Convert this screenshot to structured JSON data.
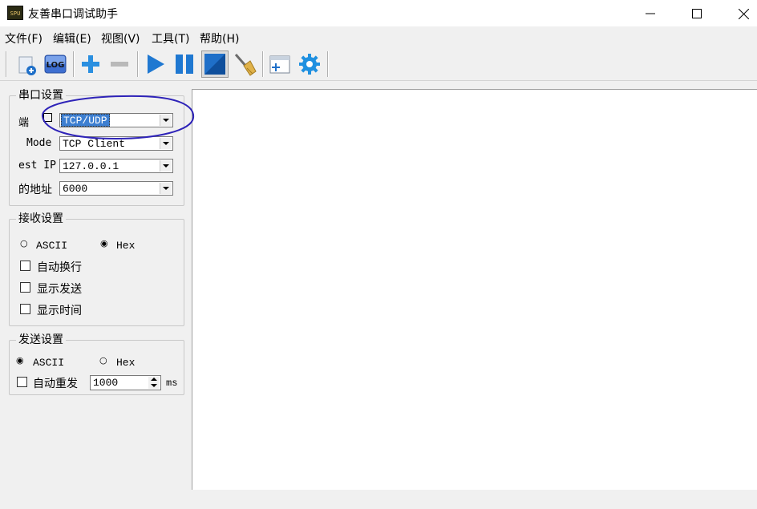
{
  "window": {
    "icon_text": "SPU",
    "title": "友善串口调试助手"
  },
  "menu": [
    {
      "label": "文件(F)"
    },
    {
      "label": "编辑(E)"
    },
    {
      "label": "视图(V)"
    },
    {
      "label": "工具(T)"
    },
    {
      "label": "帮助(H)"
    }
  ],
  "toolbar": {
    "log_label": "LOG",
    "icons": [
      "new-document-icon",
      "log-icon",
      "add-icon",
      "remove-icon",
      "play-icon",
      "pause-icon",
      "display-mode-icon",
      "clear-broom-icon",
      "new-window-icon",
      "settings-gear-icon"
    ]
  },
  "serial_settings": {
    "title": "串口设置",
    "port_label": "端",
    "port_value": "TCP/UDP",
    "mode_label": "Mode",
    "mode_value": "TCP Client",
    "host_ip_label": "est IP",
    "host_ip_value": "127.0.0.1",
    "port_addr_label": "的地址",
    "port_addr_value": "6000"
  },
  "receive_settings": {
    "title": "接收设置",
    "ascii_label": "ASCII",
    "hex_label": "Hex",
    "selected": "Hex",
    "auto_wrap_label": "自动换行",
    "show_send_label": "显示发送",
    "show_time_label": "显示时间"
  },
  "send_settings": {
    "title": "发送设置",
    "ascii_label": "ASCII",
    "hex_label": "Hex",
    "selected": "ASCII",
    "auto_resend_label": "自动重发",
    "interval_value": "1000",
    "interval_unit": "ms"
  },
  "colors": {
    "highlight_ellipse": "#2e23b8",
    "selection": "#3d7fd1",
    "accent_blue": "#1e88d6"
  }
}
